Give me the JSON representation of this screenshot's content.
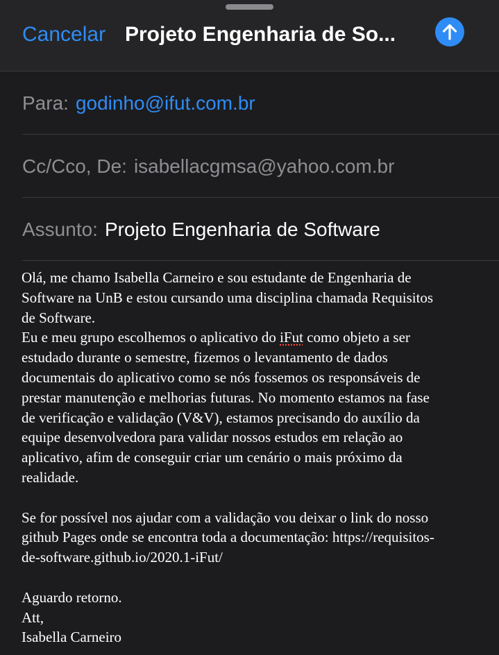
{
  "header": {
    "cancel_label": "Cancelar",
    "title": "Projeto Engenharia de So...",
    "send_icon": "arrow-up-circle"
  },
  "fields": {
    "to_label": "Para:",
    "to_value": "godinho@ifut.com.br",
    "cc_label": "Cc/Cco, De:",
    "cc_value": "isabellacgmsa@yahoo.com.br",
    "subject_label": "Assunto:",
    "subject_value": "Projeto Engenharia de Software"
  },
  "body": {
    "line1": "Olá, me chamo Isabella Carneiro e sou estudante de Engenharia de",
    "line2": "Software na UnB e estou cursando uma disciplina chamada Requisitos",
    "line3": "de Software.",
    "line4_pre": "Eu e meu grupo escolhemos o aplicativo do ",
    "line4_word": "iFut",
    "line4_post": " como objeto a ser",
    "line5": "estudado durante o semestre, fizemos o levantamento de dados",
    "line6": "documentais do aplicativo como se nós fossemos os responsáveis de",
    "line7": "prestar manutenção e melhorias futuras. No momento estamos na fase",
    "line8": "de verificação e validação (V&V), estamos precisando do auxílio da",
    "line9": "equipe desenvolvedora para validar nossos estudos em relação ao",
    "line10": "aplicativo, afim de conseguir criar um cenário o mais próximo da",
    "line11": "realidade.",
    "line12": "Se for possível nos ajudar com a validação vou deixar o link do nosso",
    "line13": "github Pages onde se encontra toda a documentação: https://requisitos-",
    "line14": "de-software.github.io/2020.1-iFut/",
    "line15": "Aguardo retorno.",
    "line16": "Att,",
    "line17": "Isabella Carneiro"
  },
  "colors": {
    "accent": "#2f8cf6",
    "background": "#1c1c1e",
    "header_background": "#252527",
    "secondary_text": "#8e8e93",
    "spellcheck": "#ff453a"
  }
}
